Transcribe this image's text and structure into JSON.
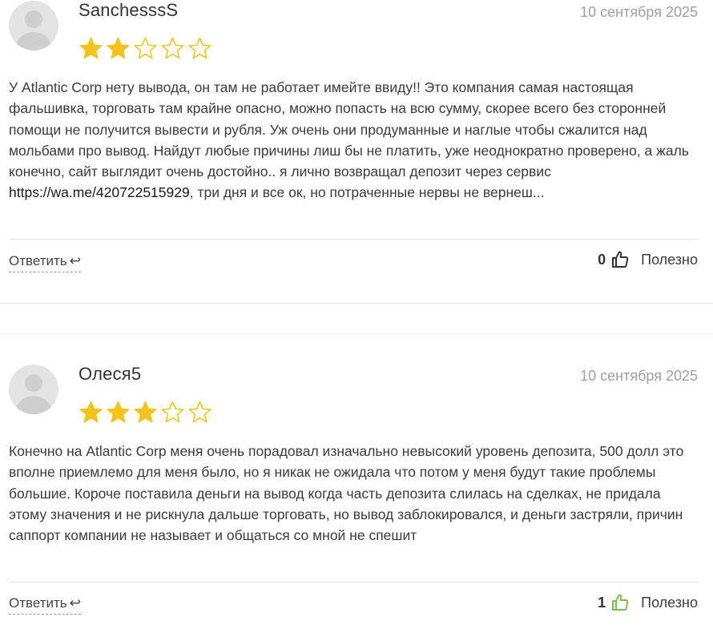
{
  "reviews": [
    {
      "author": "SanchesssS",
      "date": "10 сентября 2025",
      "rating": 2,
      "max_rating": 5,
      "text_before": "У Atlantic Corp нету вывода, он там не работает имейте ввиду!! Это компания самая настоящая фальшивка, торговать там крайне опасно, можно попасть на всю сумму, скорее всего без сторонней помощи не получится вывести и рубля. Уж очень они продуманные и наглые чтобы сжалится над мольбами про вывод. Найдут любые причины лиш бы не платить, уже неоднократно проверено, а жаль конечно, сайт выглядит очень достойно.. я лично возвращал депозит через сервис ",
      "link": "https://wa.me/420722515929",
      "text_after": ", три дня и все ок, но потраченные нервы не вернеш...",
      "reply_label": "Ответить",
      "reply_icon": "↩",
      "helpful_count": "0",
      "helpful_label": "Полезно",
      "thumb_color": "#333333"
    },
    {
      "author": "Олеся5",
      "date": "10 сентября 2025",
      "rating": 3,
      "max_rating": 5,
      "text_before": "Конечно на Atlantic Corp меня очень порадовал изначально невысокий уровень депозита, 500 долл это вполне приемлемо для меня было, но я никак не ожидала что потом у меня будут такие проблемы большие. Короче поставила деньги на вывод когда часть депозита слилась на сделках, не придала этому значения и не рискнула дальше торговать, но вывод заблокировался, и деньги застряли, причин саппорт компании не называет и общаться со мной не спешит",
      "link": "",
      "text_after": "",
      "reply_label": "Ответить",
      "reply_icon": "↩",
      "helpful_count": "1",
      "helpful_label": "Полезно",
      "thumb_color": "#7cc242"
    }
  ],
  "colors": {
    "star_filled": "#f2c31a",
    "star_outline": "#f2c31a",
    "date": "#a0a0a0"
  }
}
